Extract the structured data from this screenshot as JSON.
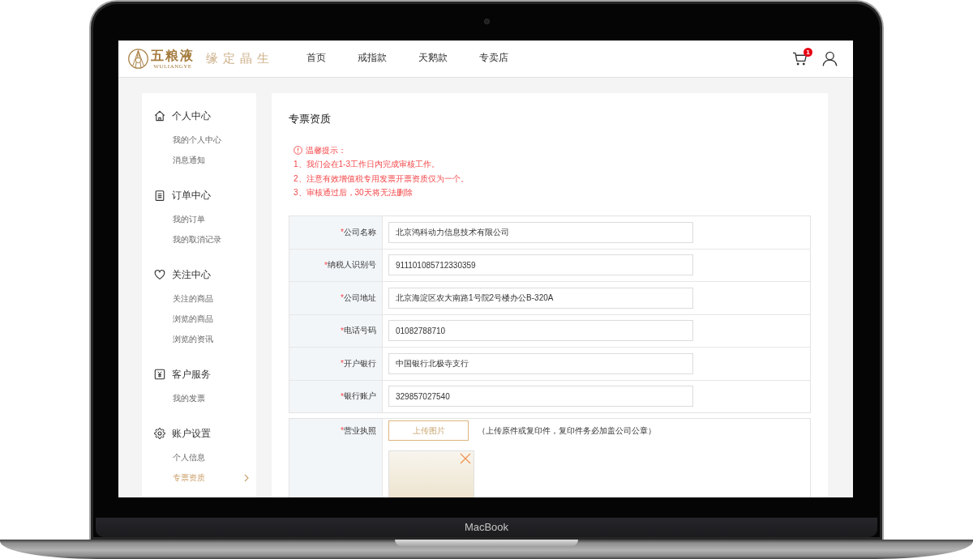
{
  "device": {
    "label": "MacBook"
  },
  "header": {
    "logo": {
      "name": "五粮液",
      "latin": "WULIANGYE"
    },
    "slogan": "缘定晶生",
    "nav": [
      {
        "label": "首页"
      },
      {
        "label": "戒指款"
      },
      {
        "label": "天鹅款"
      },
      {
        "label": "专卖店"
      }
    ],
    "cart": {
      "badge": "1"
    }
  },
  "sidebar": {
    "groups": [
      {
        "title": "个人中心",
        "items": [
          {
            "label": "我的个人中心",
            "selected": false
          },
          {
            "label": "消息通知",
            "selected": false
          }
        ]
      },
      {
        "title": "订单中心",
        "items": [
          {
            "label": "我的订单",
            "selected": false
          },
          {
            "label": "我的取消记录",
            "selected": false
          }
        ]
      },
      {
        "title": "关注中心",
        "items": [
          {
            "label": "关注的商品",
            "selected": false
          },
          {
            "label": "浏览的商品",
            "selected": false
          },
          {
            "label": "浏览的资讯",
            "selected": false
          }
        ]
      },
      {
        "title": "客户服务",
        "items": [
          {
            "label": "我的发票",
            "selected": false
          }
        ]
      },
      {
        "title": "账户设置",
        "items": [
          {
            "label": "个人信息",
            "selected": false
          },
          {
            "label": "专票资质",
            "selected": true
          }
        ]
      }
    ]
  },
  "content": {
    "title": "专票资质",
    "notice": {
      "heading": "温馨提示：",
      "lines": [
        "1、我们会在1-3工作日内完成审核工作。",
        "2、注意有效增值税专用发票开票资质仅为一个。",
        "3、审核通过后，30天将无法删除"
      ]
    },
    "fields": [
      {
        "required_mark": "*",
        "label": "公司名称",
        "value": "北京鸿科动力信息技术有限公司"
      },
      {
        "required_mark": "*",
        "label": "纳税人识别号",
        "value": "911101085712330359"
      },
      {
        "required_mark": "*",
        "label": "公司地址",
        "value": "北京海淀区农大南路1号院2号楼办公B-320A"
      },
      {
        "required_mark": "*",
        "label": "电话号码",
        "value": "01082788710"
      },
      {
        "required_mark": "*",
        "label": "开户银行",
        "value": "中国银行北极寺支行"
      },
      {
        "required_mark": "*",
        "label": "银行账户",
        "value": "329857027540"
      }
    ],
    "upload": {
      "required_mark": "*",
      "label": "营业执照",
      "button": "上传图片",
      "hint": "（上传原件或复印件，复印件务必加盖公司公章）"
    }
  }
}
